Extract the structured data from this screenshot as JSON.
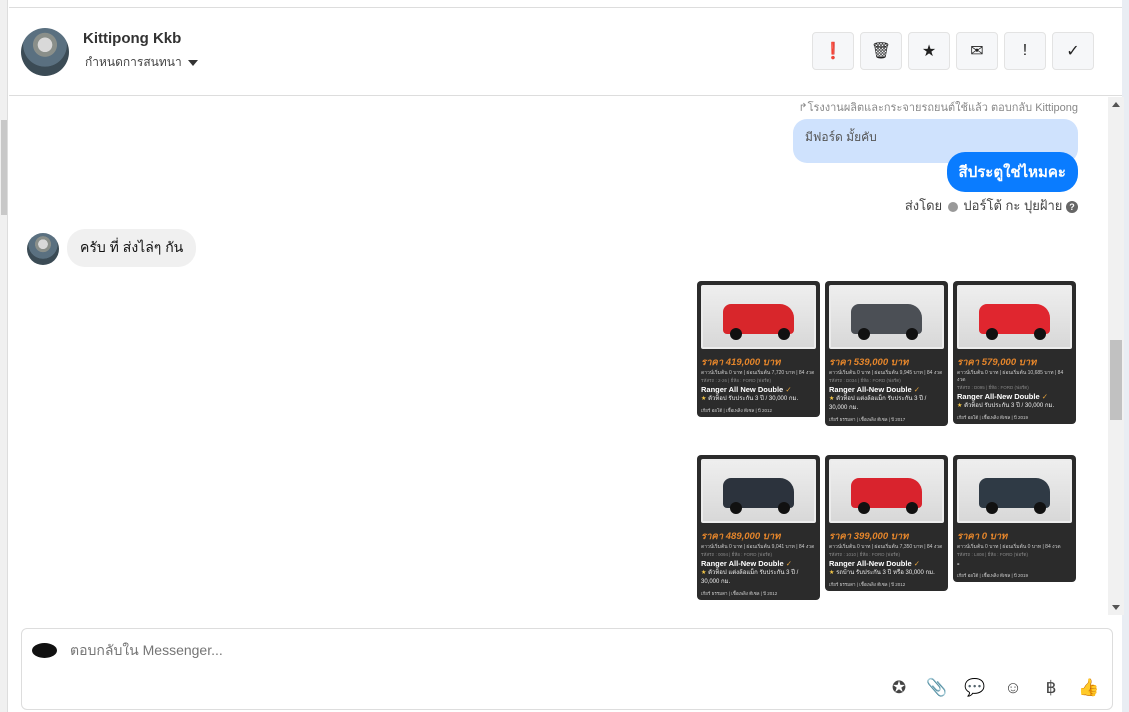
{
  "header": {
    "name": "Kittipong Kkb",
    "assign_label": "กำหนดการสนทนา",
    "actions": [
      {
        "icon": "alert-circle-icon",
        "glyph": "❗"
      },
      {
        "icon": "trash-icon",
        "glyph": "🗑"
      },
      {
        "icon": "star-icon",
        "glyph": "★"
      },
      {
        "icon": "envelope-icon",
        "glyph": "✉"
      },
      {
        "icon": "exclamation-icon",
        "glyph": "!"
      },
      {
        "icon": "check-icon",
        "glyph": "✓"
      }
    ]
  },
  "chat": {
    "reply_info": "↱โรงงานผลิตและกระจายรถยนต์ใช้แล้ว ตอบกลับ Kittipong",
    "quoted_message": "มีฟอร์ด มั้ยคับ",
    "my_message": "สีประตูใช่ไหมคะ",
    "sent_by_label": "ส่งโดย",
    "sent_by_name": "ปอร์โต้ กะ ปุยฝ้าย",
    "their_message": "ครับ ที่ ส่งไล่ๆ กัน",
    "cards": [
      {
        "price": "ราคา 419,000 บาท",
        "sub": "ดาวน์เริ่มต้น 0 บาท | ผ่อนเริ่มต้น 7,720 บาท | 84 งวด",
        "tag": "รหัสรถ : 2-26 | ยี่ห้อ : FORD (ฟอร์ด)",
        "title": "Ranger All New Double",
        "desc": "ตัวท็อป รับประกัน 3 ปี / 30,000 กม.",
        "foot": "เกียร์ ออโต้ | เชื้อเพลิง ดีเซล | ปี 2012",
        "color": "#d8262b"
      },
      {
        "price": "ราคา 539,000 บาท",
        "sub": "ดาวน์เริ่มต้น 0 บาท | ผ่อนเริ่มต้น 9,945 บาท | 84 งวด",
        "tag": "รหัสรถ : D034 | ยี่ห้อ : FORD (ฟอร์ด)",
        "title": "Ranger All-New Double",
        "desc": "ตัวท็อป แต่งล้อแม็ก รับประกัน 3 ปี / 30,000 กม.",
        "foot": "เกียร์ ธรรมดา | เชื้อเพลิง ดีเซล | ปี 2017",
        "color": "#4b4f55"
      },
      {
        "price": "ราคา 579,000 บาท",
        "sub": "ดาวน์เริ่มต้น 0 บาท | ผ่อนเริ่มต้น 10,685 บาท | 84 งวด",
        "tag": "รหัสรถ : D095 | ยี่ห้อ : FORD (ฟอร์ด)",
        "title": "Ranger All-New Double",
        "desc": "ตัวท็อป รับประกัน 3 ปี / 30,000 กม.",
        "foot": "เกียร์ ออโต้ | เชื้อเพลิง ดีเซล | ปี 2019",
        "color": "#e0262f"
      },
      {
        "price": "ราคา 489,000 บาท",
        "sub": "ดาวน์เริ่มต้น 0 บาท | ผ่อนเริ่มต้น 9,041 บาท | 84 งวด",
        "tag": "รหัสรถ : 0094 | ยี่ห้อ : FORD (ฟอร์ด)",
        "title": "Ranger All-New Double",
        "desc": "ตัวท็อป แต่งล้อแม็ก รับประกัน 3 ปี / 30,000 กม.",
        "foot": "เกียร์ ธรรมดา | เชื้อเพลิง ดีเซล | ปี 2012",
        "color": "#2c333d"
      },
      {
        "price": "ราคา 399,000 บาท",
        "sub": "ดาวน์เริ่มต้น 0 บาท | ผ่อนเริ่มต้น 7,350 บาท | 84 งวด",
        "tag": "รหัสรถ : 1010 | ยี่ห้อ : FORD (ฟอร์ด)",
        "title": "Ranger All-New Double",
        "desc": "รถบ้าน รับประกัน 3 ปี หรือ 30,000 กม.",
        "foot": "เกียร์ ธรรมดา | เชื้อเพลิง ดีเซล | ปี 2012",
        "color": "#d9232d"
      },
      {
        "price": "ราคา 0 บาท",
        "sub": "ดาวน์เริ่มต้น 0 บาท | ผ่อนเริ่มต้น 0 บาท | 84 งวด",
        "tag": "รหัสรถ : L808 | ยี่ห้อ : FORD (ฟอร์ด)",
        "title": "-",
        "desc": "",
        "foot": "เกียร์ ออโต้ | เชื้อเพลิง ดีเซล | ปี 2019",
        "color": "#2f3a45"
      }
    ]
  },
  "composer": {
    "placeholder": "ตอบกลับใน Messenger...",
    "icons": [
      {
        "icon": "saved-reply-icon",
        "glyph": "✪"
      },
      {
        "icon": "attachment-icon",
        "glyph": "📎"
      },
      {
        "icon": "chat-bubble-icon",
        "glyph": "💬"
      },
      {
        "icon": "emoji-icon",
        "glyph": "☺"
      },
      {
        "icon": "baht-icon",
        "glyph": "฿"
      },
      {
        "icon": "thumbs-up-icon",
        "glyph": "👍"
      }
    ]
  }
}
